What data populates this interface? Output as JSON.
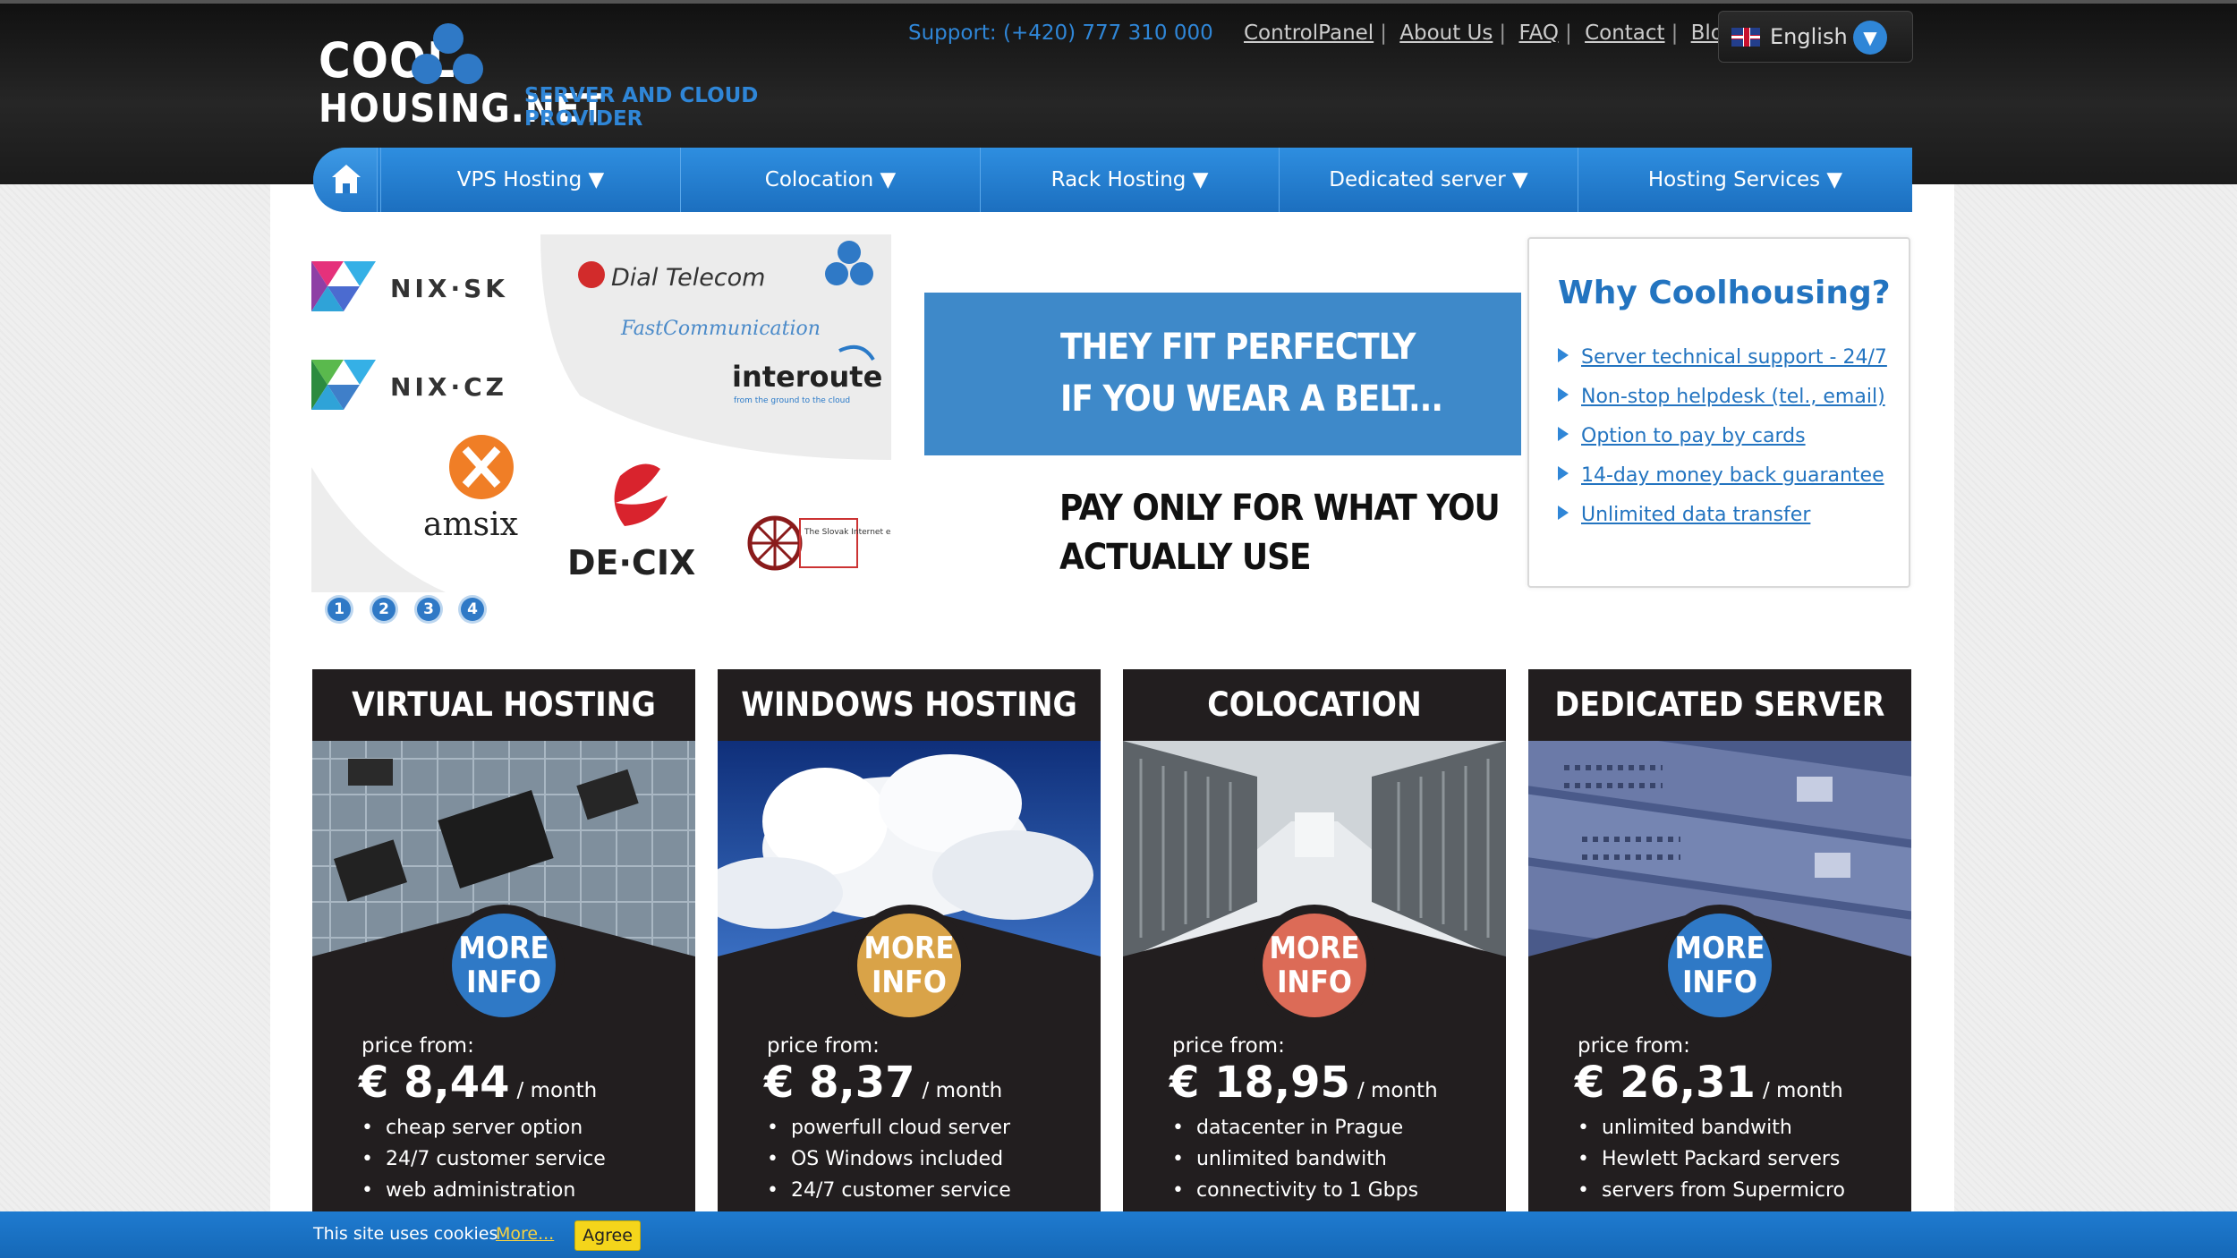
{
  "header": {
    "logo_line1": "COOL",
    "logo_line2": "HOUSING.NET",
    "tagline": "SERVER AND CLOUD PROVIDER",
    "support": "Support: (+420) 777 310 000",
    "links": [
      "ControlPanel",
      "About Us",
      "FAQ",
      "Contact",
      "Blog"
    ],
    "language": "English"
  },
  "nav": {
    "home_icon": "home-icon",
    "items": [
      "VPS Hosting ▼",
      "Colocation ▼",
      "Rack Hosting ▼",
      "Dedicated server ▼",
      "Hosting Services ▼"
    ]
  },
  "banner": {
    "logos": [
      "NIX·SK",
      "NIX·CZ",
      "Dial Telecom",
      "FastCommunication",
      "interoute",
      "from the ground to the cloud",
      "amsix",
      "DE·CIX",
      "The Slovak Internet eXchange"
    ],
    "slide_dots": [
      "1",
      "2",
      "3",
      "4"
    ]
  },
  "promo": {
    "line1": "THEY FIT PERFECTLY",
    "line2": "IF YOU WEAR A BELT...",
    "line3": "PAY ONLY FOR WHAT YOU",
    "line4": "ACTUALLY USE"
  },
  "why": {
    "title": "Why Coolhousing?",
    "items": [
      "Server technical support - 24/7",
      "Non-stop helpdesk (tel., email)",
      "Option to pay by cards",
      "14-day money back guarantee",
      "Unlimited data transfer"
    ]
  },
  "cards": [
    {
      "title": "VIRTUAL HOSTING",
      "more1": "MORE",
      "more2": "INFO",
      "more_color": "#2f79c6",
      "price_label": "price from:",
      "price": "€ 8,44",
      "per": "/ month",
      "features": [
        "cheap server option",
        "24/7 customer service",
        "web administration"
      ]
    },
    {
      "title": "WINDOWS HOSTING",
      "more1": "MORE",
      "more2": "INFO",
      "more_color": "#d9a348",
      "price_label": "price from:",
      "price": "€ 8,37",
      "per": "/ month",
      "features": [
        "powerfull cloud server",
        "OS Windows included",
        "24/7 customer service"
      ]
    },
    {
      "title": "COLOCATION",
      "more1": "MORE",
      "more2": "INFO",
      "more_color": "#dc6b57",
      "price_label": "price from:",
      "price": "€ 18,95",
      "per": "/ month",
      "features": [
        "datacenter in Prague",
        "unlimited bandwith",
        "connectivity to 1 Gbps"
      ]
    },
    {
      "title": "DEDICATED SERVER",
      "more1": "MORE",
      "more2": "INFO",
      "more_color": "#2f79c6",
      "price_label": "price from:",
      "price": "€ 26,31",
      "per": "/ month",
      "features": [
        "unlimited bandwith",
        "Hewlett Packard servers",
        "servers from Supermicro"
      ]
    }
  ],
  "cookie": {
    "text": "This site uses cookies",
    "more": "More...",
    "agree": "Agree"
  }
}
